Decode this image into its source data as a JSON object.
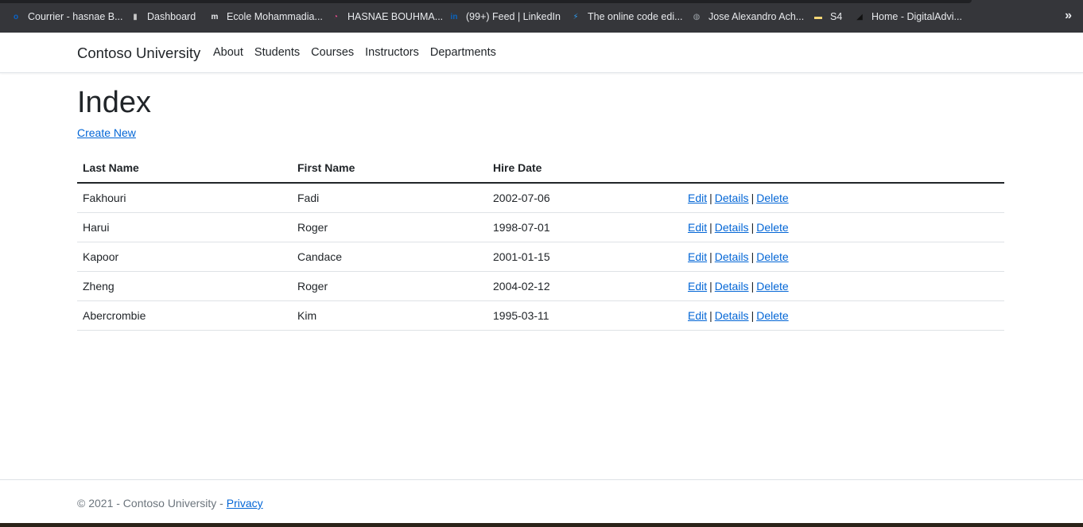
{
  "bookmarks": [
    {
      "label": "Courrier - hasnae B...",
      "icon": "outlook-icon",
      "color": "#0a64c8",
      "glyph": "o"
    },
    {
      "label": "Dashboard",
      "icon": "dashboard-icon",
      "color": "#c8c8c8",
      "glyph": "▮"
    },
    {
      "label": "Ecole Mohammadia...",
      "icon": "moodle-icon",
      "color": "#e8eaed",
      "glyph": "m"
    },
    {
      "label": "HASNAE BOUHMA...",
      "icon": "colorful-swirl-icon",
      "color": "#e04a8a",
      "glyph": "◔"
    },
    {
      "label": "(99+) Feed | LinkedIn",
      "icon": "linkedin-icon",
      "color": "#0a66c2",
      "glyph": "in"
    },
    {
      "label": "The online code edi...",
      "icon": "lightning-icon",
      "color": "#2d9bf0",
      "glyph": "⚡"
    },
    {
      "label": "Jose Alexandro Ach...",
      "icon": "globe-icon",
      "color": "#9aa0a6",
      "glyph": "◍"
    },
    {
      "label": "S4",
      "icon": "folder-icon",
      "color": "#f6d776",
      "glyph": "▬"
    },
    {
      "label": "Home - DigitalAdvi...",
      "icon": "digitaladvisor-icon",
      "color": "#111111",
      "glyph": "◢"
    }
  ],
  "bookmarks_more": "»",
  "nav": {
    "brand": "Contoso University",
    "links": [
      "About",
      "Students",
      "Courses",
      "Instructors",
      "Departments"
    ]
  },
  "page": {
    "title": "Index",
    "create_new": "Create New"
  },
  "table": {
    "headers": [
      "Last Name",
      "First Name",
      "Hire Date"
    ],
    "rows": [
      {
        "last": "Fakhouri",
        "first": "Fadi",
        "hire": "2002-07-06"
      },
      {
        "last": "Harui",
        "first": "Roger",
        "hire": "1998-07-01"
      },
      {
        "last": "Kapoor",
        "first": "Candace",
        "hire": "2001-01-15"
      },
      {
        "last": "Zheng",
        "first": "Roger",
        "hire": "2004-02-12"
      },
      {
        "last": "Abercrombie",
        "first": "Kim",
        "hire": "1995-03-11"
      }
    ],
    "actions": {
      "edit": "Edit",
      "details": "Details",
      "delete": "Delete",
      "separator": "|"
    }
  },
  "footer": {
    "text": "© 2021 - Contoso University - ",
    "privacy": "Privacy"
  }
}
